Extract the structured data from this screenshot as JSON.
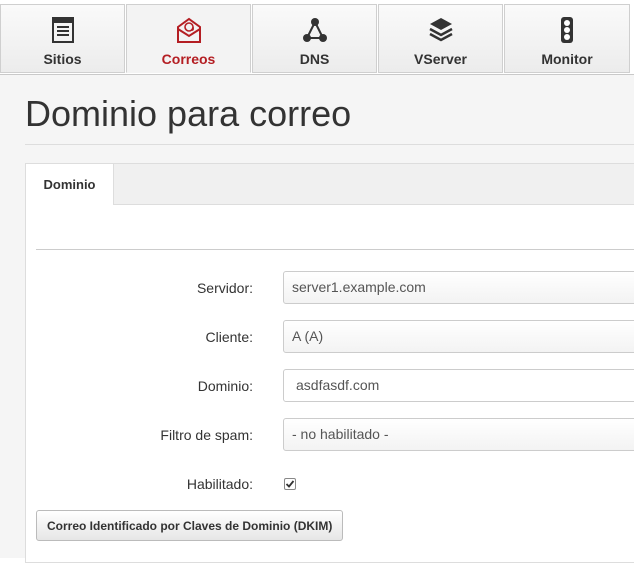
{
  "nav": {
    "tabs": [
      {
        "label": "Sitios",
        "icon": "web-page-icon"
      },
      {
        "label": "Correos",
        "icon": "email-icon",
        "active": true
      },
      {
        "label": "DNS",
        "icon": "network-nodes-icon"
      },
      {
        "label": "VServer",
        "icon": "layers-icon"
      },
      {
        "label": "Monitor",
        "icon": "traffic-light-icon"
      }
    ],
    "active_color": "#b41e23"
  },
  "page": {
    "title": "Dominio para correo"
  },
  "form": {
    "tab_label": "Dominio",
    "servidor": {
      "label": "Servidor:",
      "value": "server1.example.com"
    },
    "cliente": {
      "label": "Cliente:",
      "value": "A (A)"
    },
    "dominio": {
      "label": "Dominio:",
      "value": "asdfasdf.com"
    },
    "spam": {
      "label": "Filtro de spam:",
      "value": "- no habilitado -"
    },
    "habilitado": {
      "label": "Habilitado:",
      "checked": true
    },
    "dkim_button": "Correo Identificado por Claves de Dominio (DKIM)"
  }
}
